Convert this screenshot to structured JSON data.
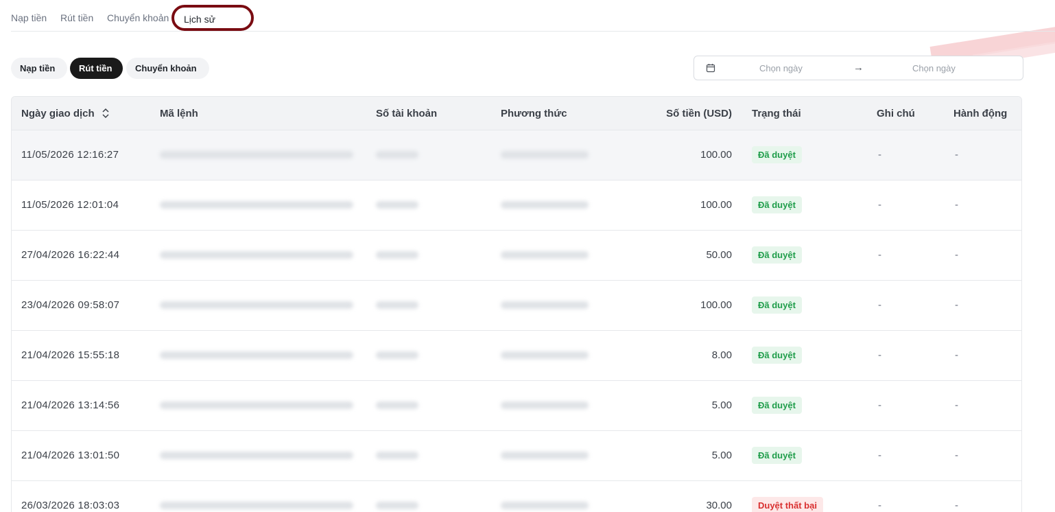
{
  "top_tabs": {
    "deposit": "Nạp tiền",
    "withdraw": "Rút tiền",
    "transfer": "Chuyển khoản",
    "history": "Lịch sử"
  },
  "filters": {
    "deposit": "Nạp tiền",
    "withdraw": "Rút tiền",
    "transfer": "Chuyển khoản",
    "active": "Rút tiền"
  },
  "date_range": {
    "start_placeholder": "Chọn ngày",
    "end_placeholder": "Chọn ngày",
    "arrow": "→"
  },
  "table": {
    "headers": {
      "date": "Ngày giao dịch",
      "order_id": "Mã lệnh",
      "account": "Số tài khoản",
      "method": "Phương thức",
      "amount": "Số tiền (USD)",
      "status": "Trạng thái",
      "note": "Ghi chú",
      "action": "Hành động"
    },
    "rows": [
      {
        "date": "11/05/2026  12:16:27",
        "amount": "100.00",
        "status": "Đã duyệt",
        "status_type": "ok",
        "note": "-",
        "action": "-"
      },
      {
        "date": "11/05/2026  12:01:04",
        "amount": "100.00",
        "status": "Đã duyệt",
        "status_type": "ok",
        "note": "-",
        "action": "-"
      },
      {
        "date": "27/04/2026  16:22:44",
        "amount": "50.00",
        "status": "Đã duyệt",
        "status_type": "ok",
        "note": "-",
        "action": "-"
      },
      {
        "date": "23/04/2026  09:58:07",
        "amount": "100.00",
        "status": "Đã duyệt",
        "status_type": "ok",
        "note": "-",
        "action": "-"
      },
      {
        "date": "21/04/2026  15:55:18",
        "amount": "8.00",
        "status": "Đã duyệt",
        "status_type": "ok",
        "note": "-",
        "action": "-"
      },
      {
        "date": "21/04/2026  13:14:56",
        "amount": "5.00",
        "status": "Đã duyệt",
        "status_type": "ok",
        "note": "-",
        "action": "-"
      },
      {
        "date": "21/04/2026  13:01:50",
        "amount": "5.00",
        "status": "Đã duyệt",
        "status_type": "ok",
        "note": "-",
        "action": "-"
      },
      {
        "date": "26/03/2026  18:03:03",
        "amount": "30.00",
        "status": "Duyệt thất bại",
        "status_type": "fail",
        "note": "-",
        "action": "-"
      }
    ]
  },
  "colors": {
    "accent_dark": "#1a1a1a",
    "highlight_ring": "#7a0c12",
    "status_ok": "#1f9d4a",
    "status_fail": "#d93030"
  }
}
